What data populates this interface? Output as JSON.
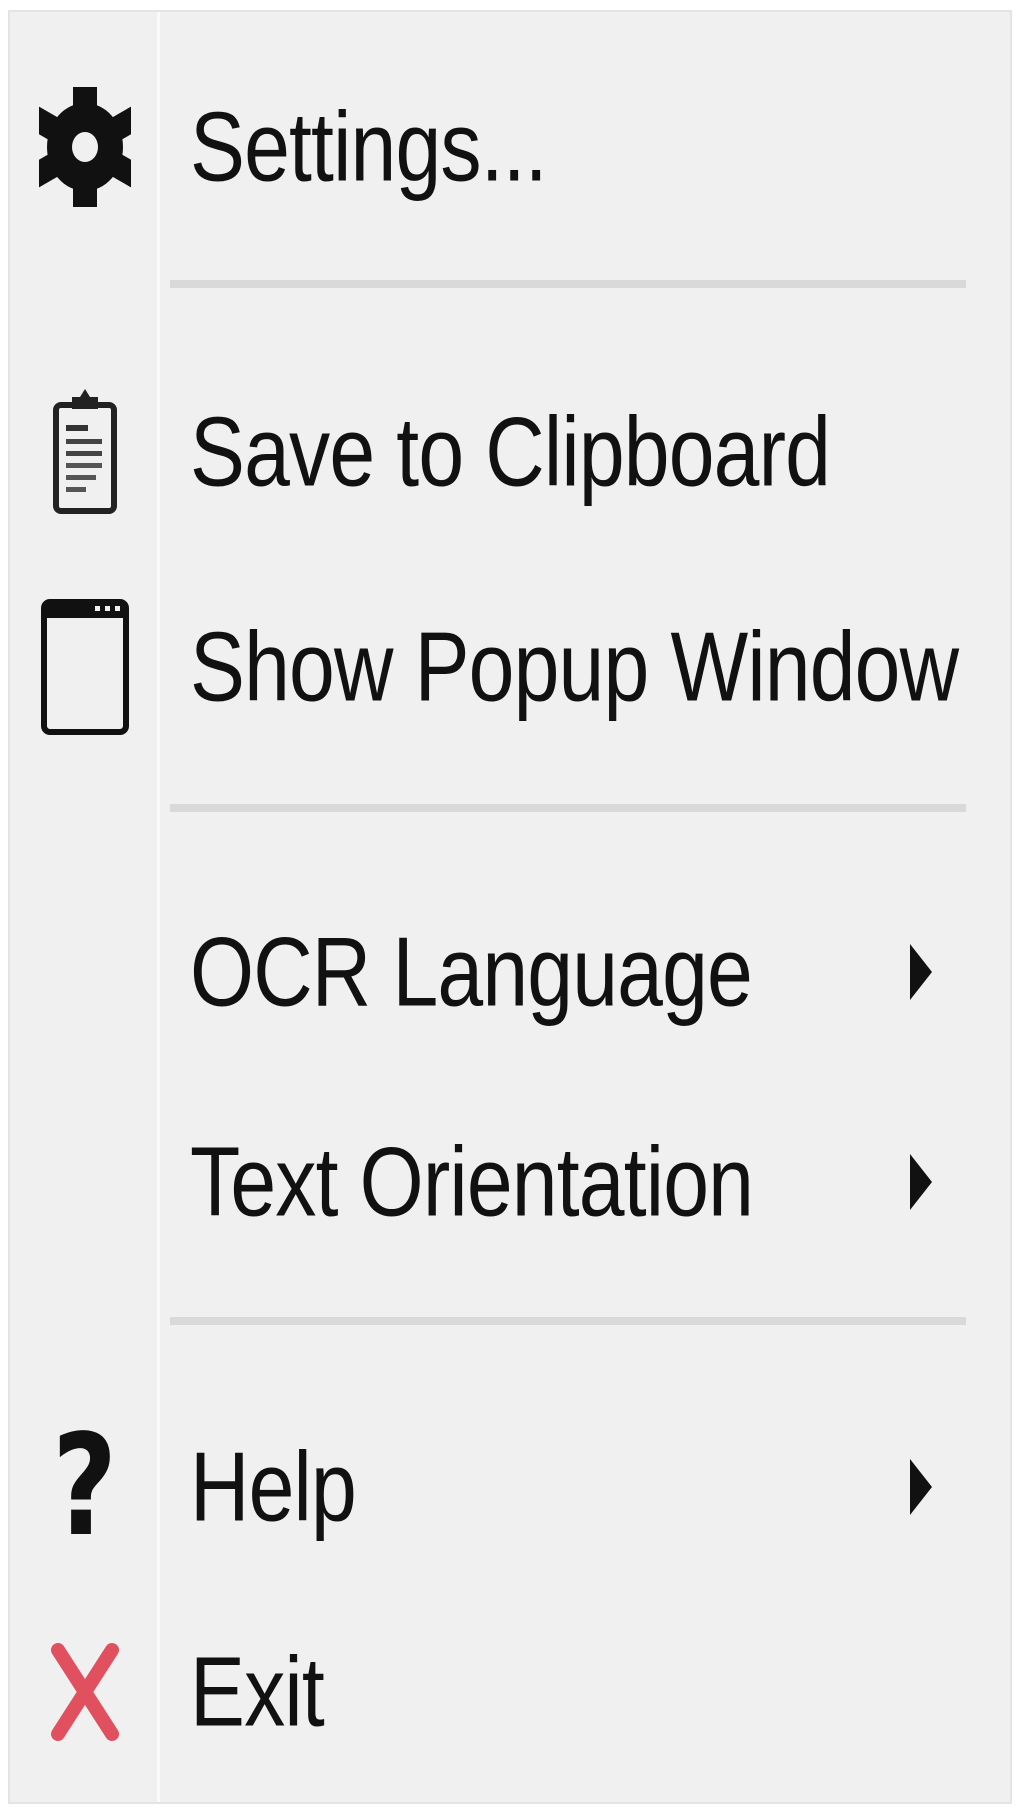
{
  "menu": {
    "items": [
      {
        "label": "Settings...",
        "icon": "gear-icon"
      },
      {
        "label": "Save to Clipboard",
        "icon": "clipboard-icon"
      },
      {
        "label": "Show Popup Window",
        "icon": "window-icon"
      },
      {
        "label": "OCR Language",
        "icon": "",
        "submenu": true
      },
      {
        "label": "Text Orientation",
        "icon": "",
        "submenu": true
      },
      {
        "label": "Help",
        "icon": "question-icon",
        "submenu": true
      },
      {
        "label": "Exit",
        "icon": "close-icon"
      }
    ]
  },
  "colors": {
    "menu_background": "#f0f0f0",
    "separator": "#d9d9d9",
    "text": "#111111",
    "exit_icon": "#e0505e"
  }
}
